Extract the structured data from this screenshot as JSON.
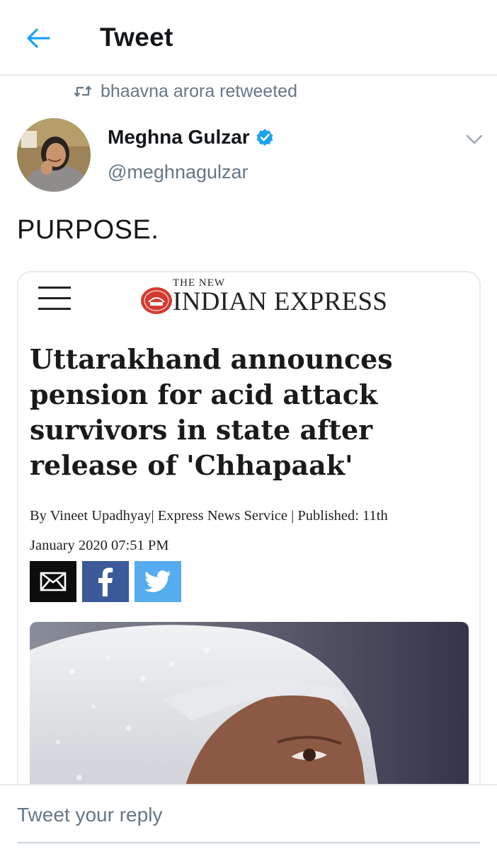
{
  "header": {
    "title": "Tweet",
    "back_icon": "arrow-left-icon",
    "accent_color": "#1da1f2"
  },
  "retweet": {
    "icon": "retweet-icon",
    "text": "bhaavna arora retweeted"
  },
  "author": {
    "name": "Meghna Gulzar",
    "verified": true,
    "handle": "@meghnagulzar",
    "verified_icon": "verified-badge-icon",
    "menu_icon": "chevron-down-icon"
  },
  "tweet": {
    "text": "PURPOSE."
  },
  "card": {
    "logo_small": "THE NEW",
    "logo_main": "INDIAN EXPRESS",
    "headline_lines": [
      "Uttarakhand announces",
      "pension for acid attack",
      "survivors in state after",
      "release of 'Chhapaak'"
    ],
    "byline_line1": "By Vineet Upadhyay| Express News Service | Published: 11th",
    "byline_line2": "January 2020 07:51 PM",
    "share": {
      "mail_icon": "mail-icon",
      "facebook_icon": "facebook-icon",
      "twitter_icon": "twitter-icon",
      "facebook_color": "#3b5a9a",
      "twitter_color": "#55acee"
    }
  },
  "reply": {
    "placeholder": "Tweet your reply"
  }
}
